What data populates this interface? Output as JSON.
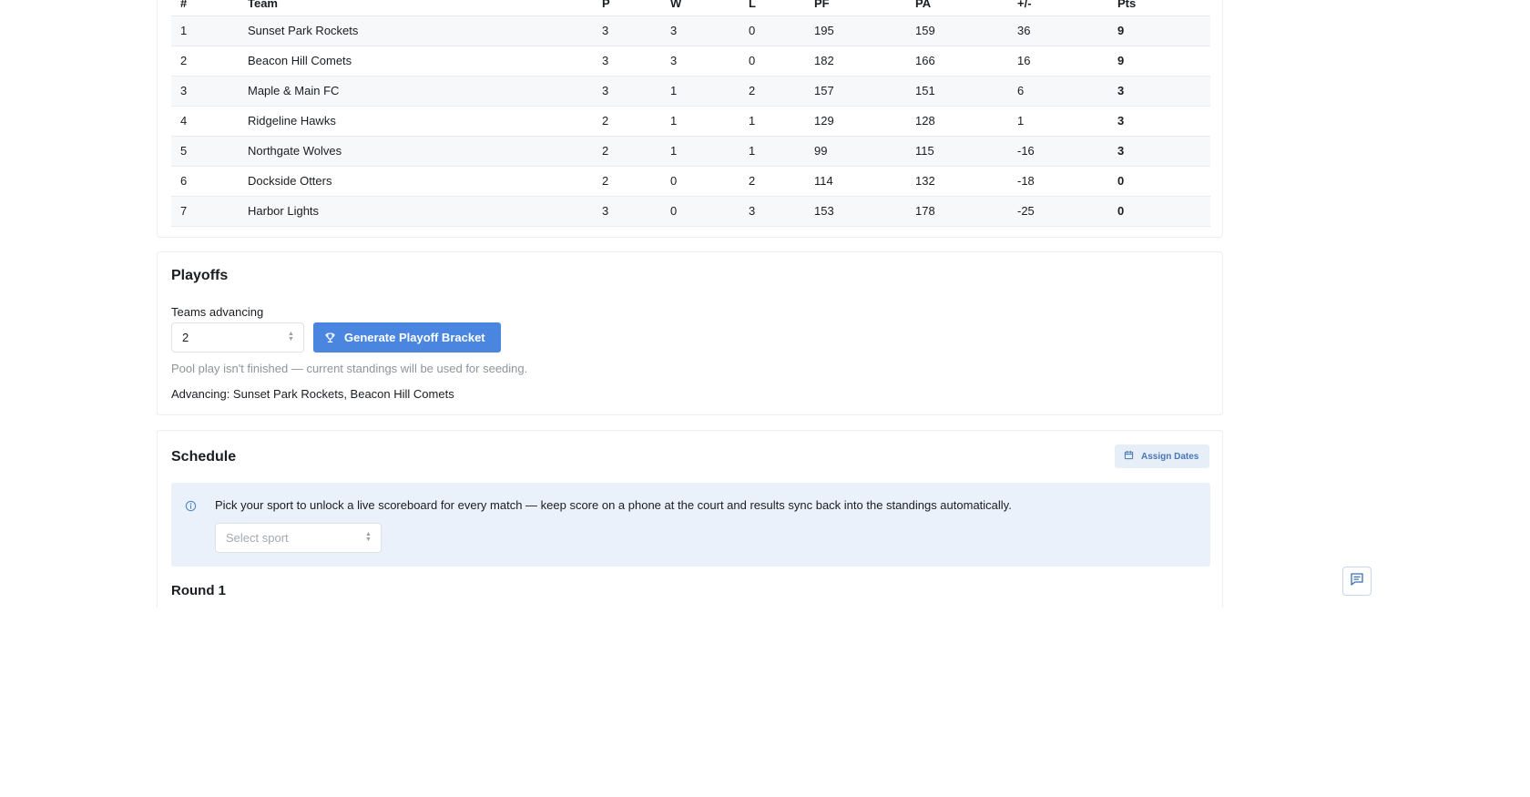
{
  "standings": {
    "columns": [
      "#",
      "Team",
      "P",
      "W",
      "L",
      "PF",
      "PA",
      "+/-",
      "Pts"
    ],
    "rows": [
      {
        "rank": "1",
        "team": "Sunset Park Rockets",
        "p": "3",
        "w": "3",
        "l": "0",
        "pf": "195",
        "pa": "159",
        "diff": "36",
        "pts": "9"
      },
      {
        "rank": "2",
        "team": "Beacon Hill Comets",
        "p": "3",
        "w": "3",
        "l": "0",
        "pf": "182",
        "pa": "166",
        "diff": "16",
        "pts": "9"
      },
      {
        "rank": "3",
        "team": "Maple & Main FC",
        "p": "3",
        "w": "1",
        "l": "2",
        "pf": "157",
        "pa": "151",
        "diff": "6",
        "pts": "3"
      },
      {
        "rank": "4",
        "team": "Ridgeline Hawks",
        "p": "2",
        "w": "1",
        "l": "1",
        "pf": "129",
        "pa": "128",
        "diff": "1",
        "pts": "3"
      },
      {
        "rank": "5",
        "team": "Northgate Wolves",
        "p": "2",
        "w": "1",
        "l": "1",
        "pf": "99",
        "pa": "115",
        "diff": "-16",
        "pts": "3"
      },
      {
        "rank": "6",
        "team": "Dockside Otters",
        "p": "2",
        "w": "0",
        "l": "2",
        "pf": "114",
        "pa": "132",
        "diff": "-18",
        "pts": "0"
      },
      {
        "rank": "7",
        "team": "Harbor Lights",
        "p": "3",
        "w": "0",
        "l": "3",
        "pf": "153",
        "pa": "178",
        "diff": "-25",
        "pts": "0"
      }
    ]
  },
  "playoffs": {
    "title": "Playoffs",
    "teams_advancing_label": "Teams advancing",
    "teams_advancing_value": "2",
    "generate_button_label": "Generate Playoff Bracket",
    "hint": "Pool play isn't finished — current standings will be used for seeding.",
    "advancing_text": "Advancing: Sunset Park Rockets, Beacon Hill Comets"
  },
  "schedule": {
    "title": "Schedule",
    "assign_dates_label": "Assign Dates",
    "info_text": "Pick your sport to unlock a live scoreboard for every match — keep score on a phone at the court and results sync back into the standings automatically.",
    "sport_select_placeholder": "Select sport",
    "round_title": "Round 1"
  },
  "icons": {
    "generate_button": "trophy-icon",
    "assign_dates_button": "calendar-icon",
    "info": "info-icon",
    "chat": "chat-icon"
  },
  "colors": {
    "primary": "#4a86e0",
    "info_bg": "#eaf1fb",
    "ghost_bg": "#e6eef8"
  }
}
